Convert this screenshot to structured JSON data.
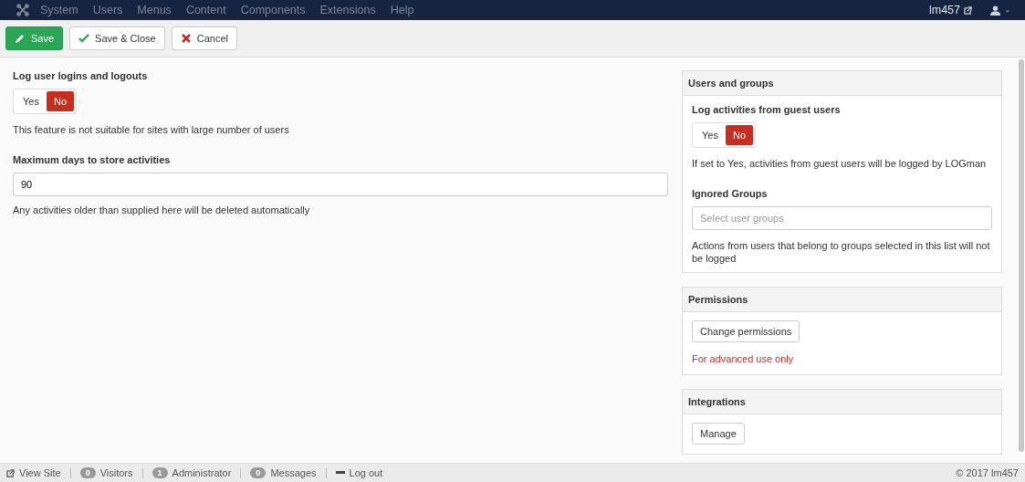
{
  "nav": {
    "items": [
      "System",
      "Users",
      "Menus",
      "Content",
      "Components",
      "Extensions",
      "Help"
    ],
    "site": "lm457"
  },
  "toolbar": [
    {
      "kind": "save",
      "label": "Save"
    },
    {
      "kind": "check",
      "label": "Save & Close"
    },
    {
      "kind": "cancel",
      "label": "Cancel"
    }
  ],
  "fields": [
    {
      "kind": "toggle",
      "label": "Log user logins and logouts",
      "options": [
        {
          "label": "Yes",
          "selected": false
        },
        {
          "label": "No",
          "selected": true
        }
      ],
      "help": "This feature is not suitable for sites with large number of users"
    },
    {
      "kind": "text",
      "label": "Maximum days to store activities",
      "value": "90",
      "help": "Any activities older than supplied here will be deleted automatically"
    }
  ],
  "panels": [
    {
      "title": "Users and groups",
      "fields": [
        {
          "kind": "toggle",
          "label": "Log activities from guest users",
          "options": [
            {
              "label": "Yes",
              "selected": false
            },
            {
              "label": "No",
              "selected": true
            }
          ],
          "help": "If set to Yes, activities from guest users will be logged by LOGman"
        },
        {
          "kind": "select",
          "label": "Ignored Groups",
          "placeholder": "Select user groups",
          "help": "Actions from users that belong to groups selected in this list will not be logged"
        }
      ]
    },
    {
      "title": "Permissions",
      "fields": [
        {
          "kind": "button",
          "label": "Change permissions"
        },
        {
          "kind": "note",
          "label": "For advanced use only"
        }
      ]
    },
    {
      "title": "Integrations",
      "fields": [
        {
          "kind": "button",
          "label": "Manage"
        }
      ]
    }
  ],
  "footer": [
    {
      "kind": "link",
      "label": "View Site"
    },
    {
      "kind": "count",
      "count": "0",
      "label": "Visitors"
    },
    {
      "kind": "count",
      "count": "1",
      "label": "Administrator"
    },
    {
      "kind": "count",
      "count": "0",
      "label": "Messages"
    },
    {
      "kind": "logout",
      "label": "Log out"
    }
  ],
  "copyright": "© 2017 lm457"
}
